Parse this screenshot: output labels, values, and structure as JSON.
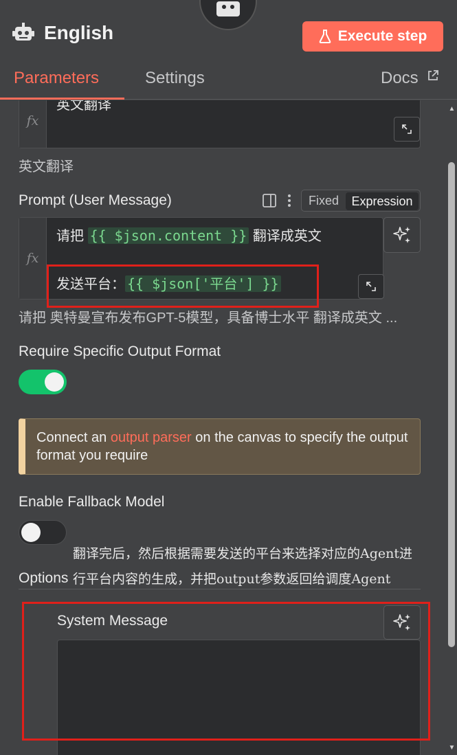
{
  "header": {
    "title": "English",
    "execute_label": "Execute step"
  },
  "tabs": [
    {
      "label": "Parameters"
    },
    {
      "label": "Settings"
    },
    {
      "label": "Docs"
    }
  ],
  "fields": {
    "prev_field_value": "英文翻译",
    "prev_field_hint": "英文翻译",
    "prompt_label": "Prompt (User Message)",
    "mode_fixed": "Fixed",
    "mode_expression": "Expression",
    "prompt_line1_prefix": "请把",
    "prompt_line1_expr": "{{ $json.content }}",
    "prompt_line1_suffix": "翻译成英文",
    "prompt_line2_prefix": "发送平台：",
    "prompt_line2_expr": "{{ $json['平台'] }}",
    "prompt_preview": "请把 奥特曼宣布发布GPT-5模型，具备博士水平 翻译成英文 ...",
    "require_format_label": "Require Specific Output Format",
    "require_format_on": true,
    "notice_prefix": "Connect an",
    "notice_link": "output parser",
    "notice_suffix": "on the canvas to specify the output format you require",
    "fallback_label": "Enable Fallback Model",
    "fallback_on": false,
    "options_label": "Options",
    "system_message_label": "System Message",
    "system_message_value": "翻译完后，然后根据需要发送的平台来选择对应的Agent进行平台内容的生成，并把output参数返回给调度Agent"
  },
  "colors": {
    "accent": "#ff6d5a",
    "toggle_on": "#13c36b",
    "toggle_off": "#2b2c2e"
  }
}
